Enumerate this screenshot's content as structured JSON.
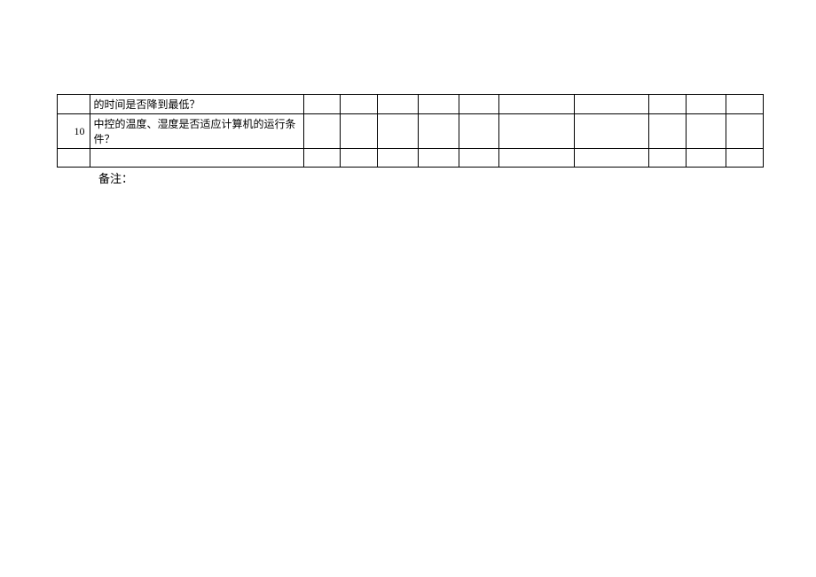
{
  "table": {
    "rows": [
      {
        "num": "",
        "desc": "的时间是否降到最低？",
        "cells": [
          "",
          "",
          "",
          "",
          "",
          "",
          "",
          "",
          "",
          ""
        ]
      },
      {
        "num": "10",
        "desc": "中控的温度、湿度是否适应计算机的运行条件？",
        "cells": [
          "",
          "",
          "",
          "",
          "",
          "",
          "",
          "",
          "",
          ""
        ]
      },
      {
        "num": "",
        "desc": "",
        "cells": [
          "",
          "",
          "",
          "",
          "",
          "",
          "",
          "",
          "",
          ""
        ]
      }
    ]
  },
  "notes_label": "备注："
}
